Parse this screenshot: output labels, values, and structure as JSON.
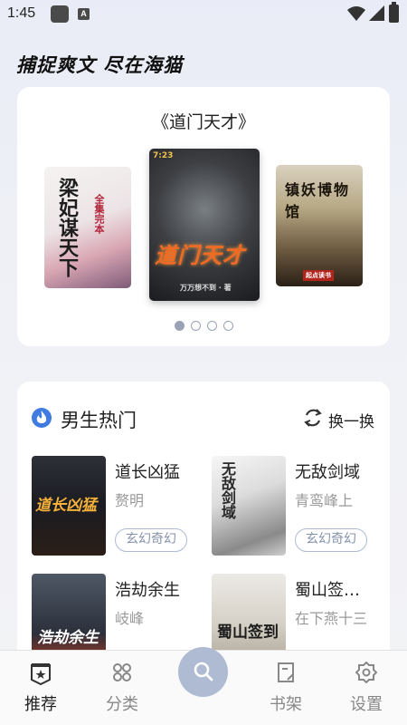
{
  "status_bar": {
    "time": "1:45",
    "a_badge": "A"
  },
  "slogan": "捕捉爽文 尽在海猫",
  "carousel": {
    "title": "《道门天才》",
    "covers": [
      {
        "title": "梁妃谋天下",
        "subtitle": "全集完本"
      },
      {
        "title": "道门天才",
        "author": "万万想不到 · 著",
        "tag": "7:23"
      },
      {
        "title": "镇妖博物馆",
        "badge": "起点读书"
      }
    ],
    "active_index": 0,
    "dot_count": 4
  },
  "hot_section": {
    "title": "男生热门",
    "refresh_label": "换一换",
    "books": [
      {
        "name": "道长凶猛",
        "author": "赘明",
        "tag": "玄幻奇幻",
        "cover_text": "道长凶猛"
      },
      {
        "name": "无敌剑域",
        "author": "青鸾峰上",
        "tag": "玄幻奇幻",
        "cover_text": "无敌剑域"
      },
      {
        "name": "浩劫余生",
        "author": "岐峰",
        "tag": "",
        "cover_text": "浩劫余生"
      },
      {
        "name": "蜀山签…",
        "author": "在下燕十三",
        "tag": "",
        "cover_text": "蜀山签到"
      }
    ]
  },
  "bottom_nav": {
    "items": [
      {
        "label": "推荐",
        "icon": "recommend-icon",
        "active": true
      },
      {
        "label": "分类",
        "icon": "category-icon",
        "active": false
      },
      {
        "label": "",
        "icon": "search-icon",
        "active": false
      },
      {
        "label": "书架",
        "icon": "bookshelf-icon",
        "active": false
      },
      {
        "label": "设置",
        "icon": "settings-icon",
        "active": false
      }
    ]
  },
  "colors": {
    "accent": "#aebbd3",
    "fire_badge": "#3f7be0",
    "tag_text": "#8592ab"
  }
}
